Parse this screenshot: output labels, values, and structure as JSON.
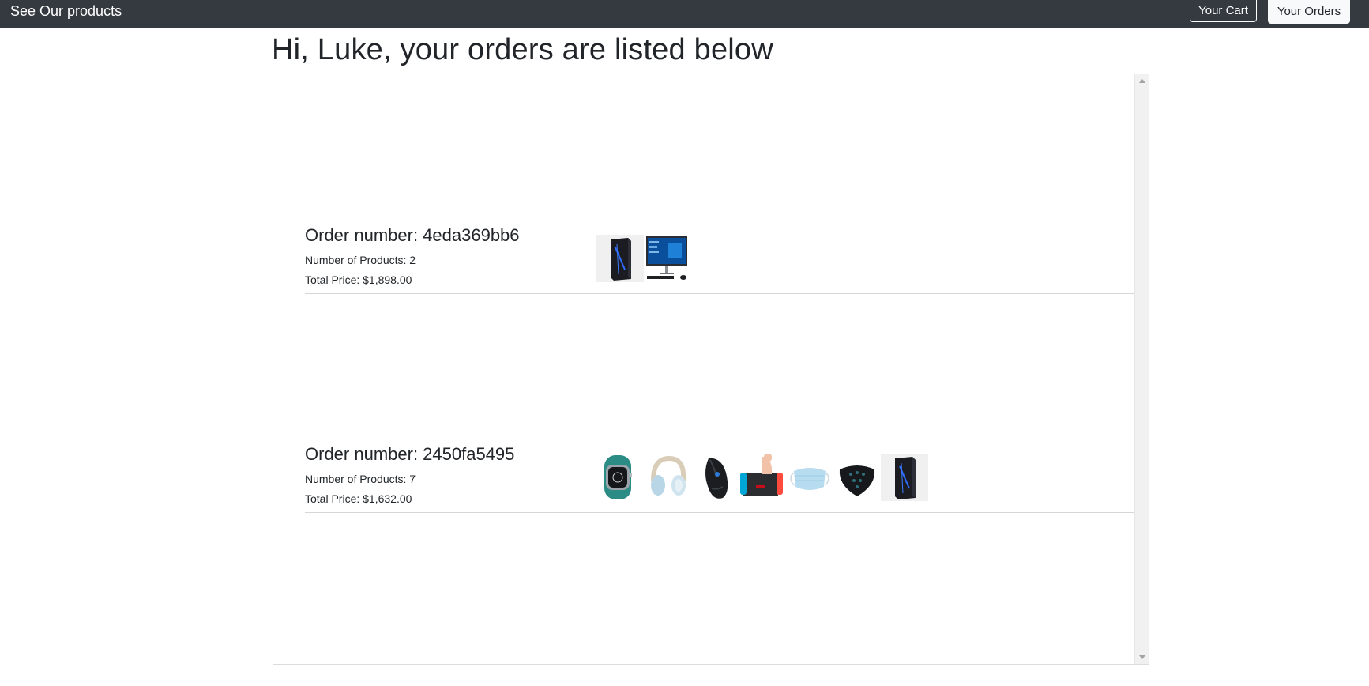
{
  "navbar": {
    "brand": "See Our products",
    "cart_label": "Your Cart",
    "orders_label": "Your Orders"
  },
  "page": {
    "title": "Hi, Luke, your orders are listed below"
  },
  "orders": [
    {
      "number_text": "Order number: 4eda369bb6",
      "count_text": "Number of Products: 2",
      "total_text": "Total Price: $1,898.00",
      "products": [
        "gaming-pc-tower-icon",
        "all-in-one-desktop-icon"
      ]
    },
    {
      "number_text": "Order number: 2450fa5495",
      "count_text": "Number of Products: 7",
      "total_text": "Total Price: $1,632.00",
      "products": [
        "smartwatch-icon",
        "headphones-icon",
        "gaming-mouse-icon",
        "game-console-icon",
        "surgical-mask-icon",
        "cloth-mask-icon",
        "gaming-pc-tower-icon"
      ]
    }
  ],
  "colors": {
    "navbar_bg": "#343a40",
    "text": "#212529",
    "border": "#d6d6d6"
  }
}
